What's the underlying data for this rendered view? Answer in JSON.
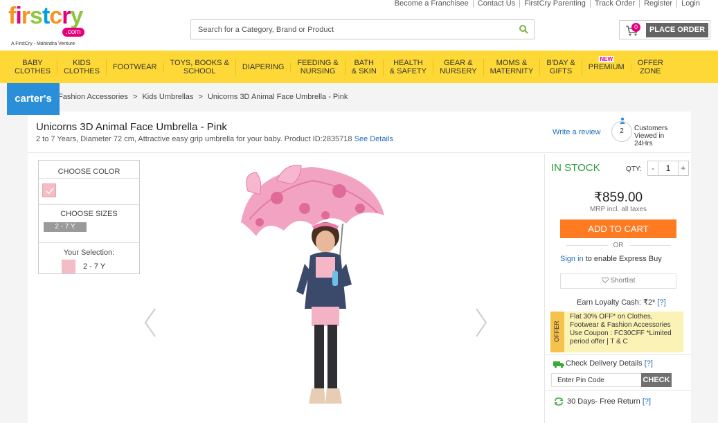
{
  "header": {
    "logo_word": "firstcry",
    "logo_com": ".com",
    "logo_tagline": "A FirstCry - Mahindra Venture",
    "top_links": [
      "Become a Franchisee",
      "Contact Us",
      "FirstCry Parenting",
      "Track Order",
      "Register",
      "Login"
    ],
    "search_placeholder": "Search for a Category, Brand or Product",
    "cart_count": "0",
    "place_order_label": "PLACE ORDER"
  },
  "nav": {
    "items": [
      {
        "line1": "BABY",
        "line2": "CLOTHES"
      },
      {
        "line1": "KIDS",
        "line2": "CLOTHES"
      },
      {
        "line1": "FOOTWEAR",
        "line2": ""
      },
      {
        "line1": "TOYS, BOOKS &",
        "line2": "SCHOOL"
      },
      {
        "line1": "DIAPERING",
        "line2": ""
      },
      {
        "line1": "FEEDING &",
        "line2": "NURSING"
      },
      {
        "line1": "BATH",
        "line2": "& SKIN"
      },
      {
        "line1": "HEALTH",
        "line2": "& SAFETY"
      },
      {
        "line1": "GEAR &",
        "line2": "NURSERY"
      },
      {
        "line1": "MOMS &",
        "line2": "MATERNITY"
      },
      {
        "line1": "B'DAY &",
        "line2": "GIFTS"
      },
      {
        "line1": "PREMIUM",
        "line2": "",
        "badge": "NEW"
      },
      {
        "line1": "OFFER",
        "line2": "ZONE"
      }
    ]
  },
  "brand_badge": "carter's",
  "breadcrumbs": [
    "Fashion Accessories",
    ">",
    "Kids Umbrellas",
    ">",
    "Unicorns 3D Animal Face Umbrella - Pink"
  ],
  "product": {
    "title": "Unicorns 3D Animal Face Umbrella - Pink",
    "description": "2 to 7 Years, Diameter 72 cm, Attractive easy grip umbrella for your baby. Product ID:2835718",
    "see_details": "See Details",
    "write_review": "Write a review",
    "viewers_count": "2",
    "viewers_text": "Customers Viewed in 24Hrs"
  },
  "options": {
    "choose_color": "CHOOSE COLOR",
    "choose_sizes": "CHOOSE SIZES",
    "size": "2 - 7 Y",
    "your_selection": "Your Selection:",
    "selection_value": "2 - 7 Y",
    "swatch_color": "#f4bcc6"
  },
  "buy": {
    "stock": "IN STOCK",
    "qty_label": "QTY:",
    "qty_minus": "-",
    "qty_value": "1",
    "qty_plus": "+",
    "price": "₹859.00",
    "mrp_note": "MRP incl. all taxes",
    "add_to_cart": "ADD TO CART",
    "or": "OR",
    "signin_link": "Sign in",
    "signin_rest": " to enable Express Buy",
    "shortlist": "Shortlist",
    "loyalty": "Earn Loyalty Cash: ₹2* ",
    "loyalty_help": "[?]",
    "offer_tag": "OFFER",
    "offer_text": "Flat 30% OFF* on Clothes, Footwear & Fashion Accessories Use Coupon : FC30CFF *Limited period offer | T & C",
    "delivery_label": "Check Delivery Details ",
    "delivery_help": "[?]",
    "pin_placeholder": "Enter Pin Code",
    "check_label": "CHECK",
    "return_label": "30 Days- Free Return ",
    "return_help": "[?]",
    "accent_orange": "#ff7b22",
    "stock_green": "#2b9a3b",
    "nav_yellow": "#fdd836"
  }
}
